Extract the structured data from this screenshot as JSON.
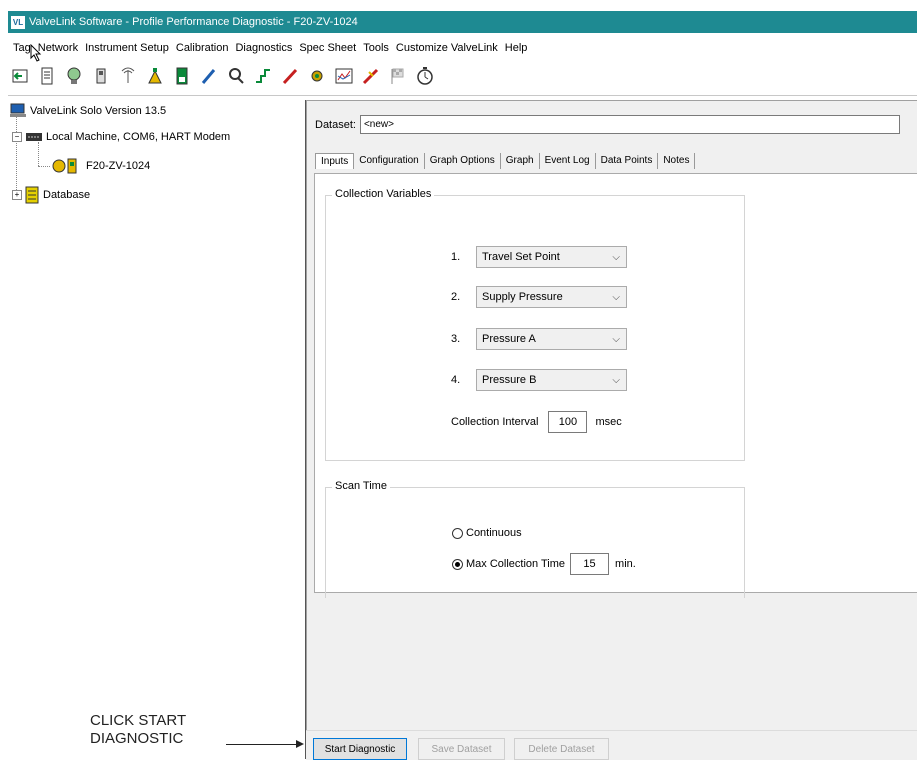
{
  "window": {
    "title": "ValveLink Software - Profile Performance Diagnostic - F20-ZV-1024",
    "icon_text": "VL"
  },
  "menu": [
    "Tag",
    "Network",
    "Instrument Setup",
    "Calibration",
    "Diagnostics",
    "Spec Sheet",
    "Tools",
    "Customize ValveLink",
    "Help"
  ],
  "toolbar": {
    "icons": [
      "back-arrow-icon",
      "document-icon",
      "globe-head-icon",
      "device-icon",
      "signal-icon",
      "valve-icon",
      "instrument-icon",
      "calibrate-pen-icon",
      "search-person-icon",
      "step-response-icon",
      "red-pen-icon",
      "gear-bug-icon",
      "chart-icon",
      "ramp-icon",
      "checkered-flag-icon",
      "stopwatch-icon"
    ]
  },
  "tree": {
    "root": "ValveLink Solo Version 13.5",
    "machine": "Local Machine, COM6, HART Modem",
    "device": "F20-ZV-1024",
    "database": "Database",
    "expander_minus": "−",
    "expander_plus": "+"
  },
  "dataset": {
    "label": "Dataset:",
    "value": "<new>"
  },
  "tabs": [
    "Inputs",
    "Configuration",
    "Graph Options",
    "Graph",
    "Event Log",
    "Data Points",
    "Notes"
  ],
  "collection": {
    "group_label": "Collection Variables",
    "variables": [
      {
        "num": "1.",
        "value": "Travel Set Point"
      },
      {
        "num": "2.",
        "value": "Supply Pressure"
      },
      {
        "num": "3.",
        "value": "Pressure A"
      },
      {
        "num": "4.",
        "value": "Pressure B"
      }
    ],
    "interval_label": "Collection Interval",
    "interval_value": "100",
    "interval_unit": "msec"
  },
  "scan": {
    "group_label": "Scan Time",
    "continuous_label": "Continuous",
    "max_label": "Max Collection Time",
    "max_value": "15",
    "max_unit": "min."
  },
  "buttons": {
    "start": "Start Diagnostic",
    "save": "Save Dataset",
    "delete": "Delete Dataset"
  },
  "callout": {
    "line1": "CLICK START",
    "line2": "DIAGNOSTIC"
  }
}
